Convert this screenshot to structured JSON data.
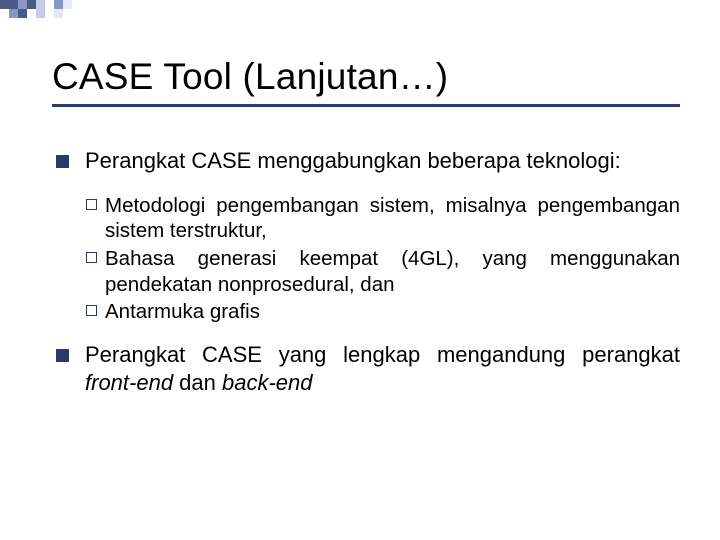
{
  "title": "CASE Tool (Lanjutan…)",
  "bullets": {
    "b1": "Perangkat CASE menggabungkan beberapa teknologi:",
    "b1_subs": {
      "s1": "Metodologi pengembangan sistem, misalnya pengembangan sistem terstruktur,",
      "s2": "Bahasa generasi keempat (4GL), yang menggunakan pendekatan nonprosedural, dan",
      "s3": "Antarmuka grafis"
    },
    "b2_pre": "Perangkat CASE yang lengkap mengandung perangkat ",
    "b2_i1": "front-end",
    "b2_mid": " dan ",
    "b2_i2": "back-end"
  }
}
